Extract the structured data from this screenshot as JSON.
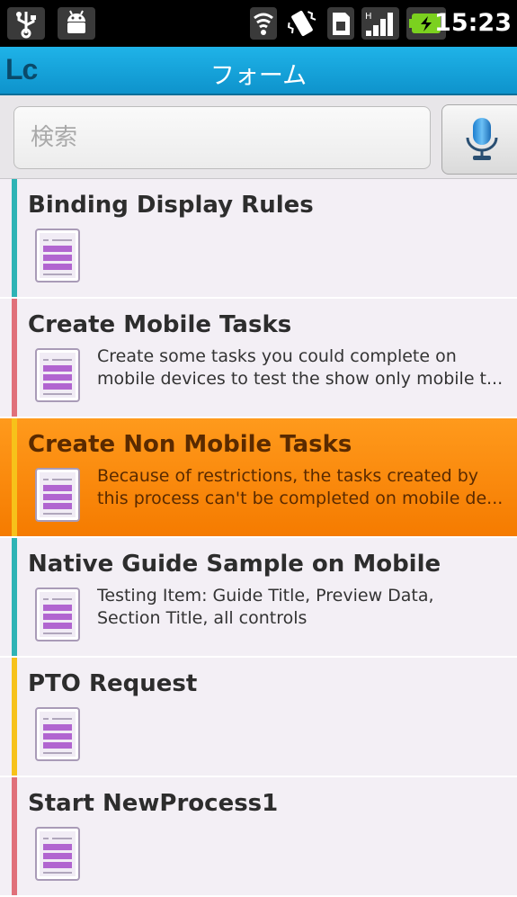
{
  "status_bar": {
    "time": "15:23",
    "icons": [
      "usb-icon",
      "android-debug-icon",
      "wifi-icon",
      "vibrate-icon",
      "sim-icon",
      "signal-icon",
      "battery-charging-icon"
    ]
  },
  "app_bar": {
    "logo": "Lc",
    "title": "フォーム",
    "accent_color": "#13a4db"
  },
  "search": {
    "placeholder": "検索",
    "mic_icon": "microphone-icon"
  },
  "forms": [
    {
      "title": "Binding Display Rules",
      "description": [],
      "bar_color": "#2eb3b5",
      "selected": false
    },
    {
      "title": "Create Mobile Tasks",
      "description": [
        "Create some tasks you could complete on",
        "mobile devices to test the show only mobile t..."
      ],
      "bar_color": "#e0707a",
      "selected": false
    },
    {
      "title": "Create Non Mobile Tasks",
      "description": [
        "Because of restrictions, the tasks created by",
        "this process can't be completed on mobile de..."
      ],
      "bar_color": "#f7c21a",
      "selected": true
    },
    {
      "title": "Native Guide  Sample on Mobile",
      "description": [
        "Testing Item: Guide Title, Preview Data,",
        "Section Title, all controls"
      ],
      "bar_color": "#2eb3b5",
      "selected": false
    },
    {
      "title": "PTO Request",
      "description": [],
      "bar_color": "#f7c21a",
      "selected": false
    },
    {
      "title": "Start NewProcess1",
      "description": [],
      "bar_color": "#e0707a",
      "selected": false
    }
  ],
  "colors": {
    "selected_item": "#f88a0a",
    "list_background": "#f3eff5"
  }
}
